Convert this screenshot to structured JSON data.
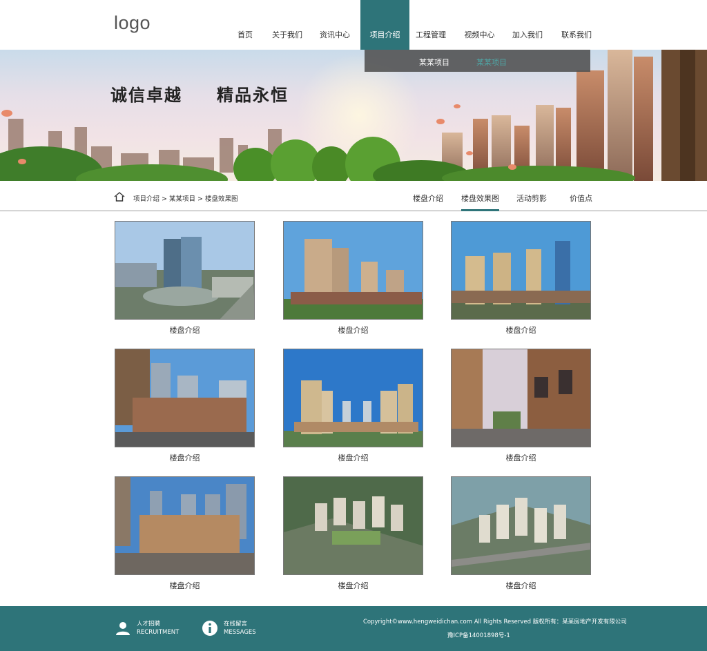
{
  "header": {
    "logo": "logo",
    "nav": [
      {
        "label": "首页"
      },
      {
        "label": "关于我们"
      },
      {
        "label": "资讯中心"
      },
      {
        "label": "项目介绍",
        "active": true
      },
      {
        "label": "工程管理"
      },
      {
        "label": "视频中心"
      },
      {
        "label": "加入我们"
      },
      {
        "label": "联系我们"
      }
    ],
    "subnav": [
      "某某项目",
      "某某项目"
    ]
  },
  "banner": {
    "slogan_left": "诚信卓越",
    "slogan_right": "精品永恒"
  },
  "breadcrumb": {
    "path": "项目介绍 > 某某项目 > 楼盘效果图",
    "tabs": [
      {
        "label": "楼盘介绍"
      },
      {
        "label": "楼盘效果图",
        "active": true
      },
      {
        "label": "活动剪影"
      },
      {
        "label": "价值点"
      }
    ]
  },
  "gallery": [
    {
      "caption": "楼盘介绍"
    },
    {
      "caption": "楼盘介绍"
    },
    {
      "caption": "楼盘介绍"
    },
    {
      "caption": "楼盘介绍"
    },
    {
      "caption": "楼盘介绍"
    },
    {
      "caption": "楼盘介绍"
    },
    {
      "caption": "楼盘介绍"
    },
    {
      "caption": "楼盘介绍"
    },
    {
      "caption": "楼盘介绍"
    }
  ],
  "footer": {
    "recruit_cn": "人才招聘",
    "recruit_en": "RECRUITMENT",
    "messages_cn": "在线留言",
    "messages_en": "MESSAGES",
    "copyright": "Copyright©www.hengweidichan.com All Rights Reserved 版权所有：某某房地产开发有限公司",
    "icp": "豫ICP备14001898号-1"
  },
  "colors": {
    "accent": "#2e7479",
    "subnav_bg": "#505050",
    "subnav_highlight": "#4fa6a6"
  }
}
